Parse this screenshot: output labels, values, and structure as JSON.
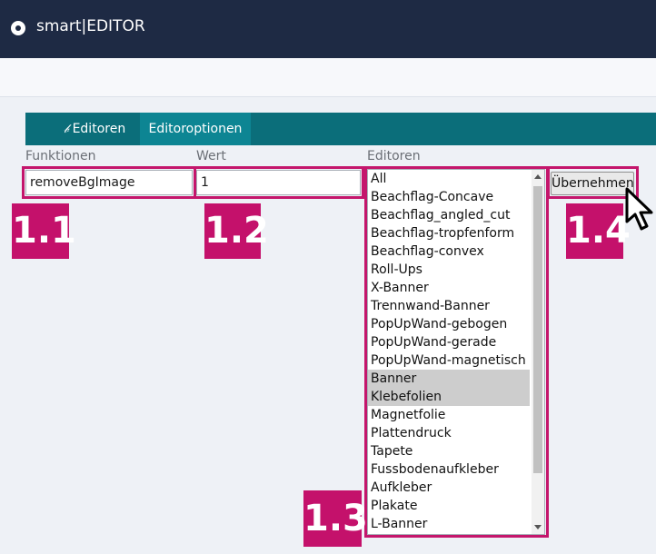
{
  "app": {
    "title": "smart|EDITOR",
    "logo_icon": "target-dot-icon"
  },
  "tabs": [
    {
      "label": "Editoren",
      "icon": "brush-icon"
    },
    {
      "label": "Editoroptionen",
      "active": true
    }
  ],
  "columns": {
    "functions": "Funktionen",
    "value": "Wert",
    "editors": "Editoren"
  },
  "form": {
    "function_value": "removeBgImage",
    "value_value": "1"
  },
  "editors_list": [
    "All",
    "Beachflag-Concave",
    "Beachflag_angled_cut",
    "Beachflag-tropfenform",
    "Beachflag-convex",
    "Roll-Ups",
    "X-Banner",
    "Trennwand-Banner",
    "PopUpWand-gebogen",
    "PopUpWand-gerade",
    "PopUpWand-magnetisch",
    "Banner",
    "Klebefolien",
    "Magnetfolie",
    "Plattendruck",
    "Tapete",
    "Fussbodenaufkleber",
    "Aufkleber",
    "Plakate",
    "L-Banner"
  ],
  "selected_editors": [
    "Banner",
    "Klebefolien"
  ],
  "apply_button": "Übernehmen",
  "badges": {
    "b1": "1.1",
    "b2": "1.2",
    "b3": "1.3",
    "b4": "1.4"
  },
  "colors": {
    "highlight": "#c4116b",
    "tab_bar": "#0b6e7a",
    "top_bar": "#1e2a44"
  }
}
